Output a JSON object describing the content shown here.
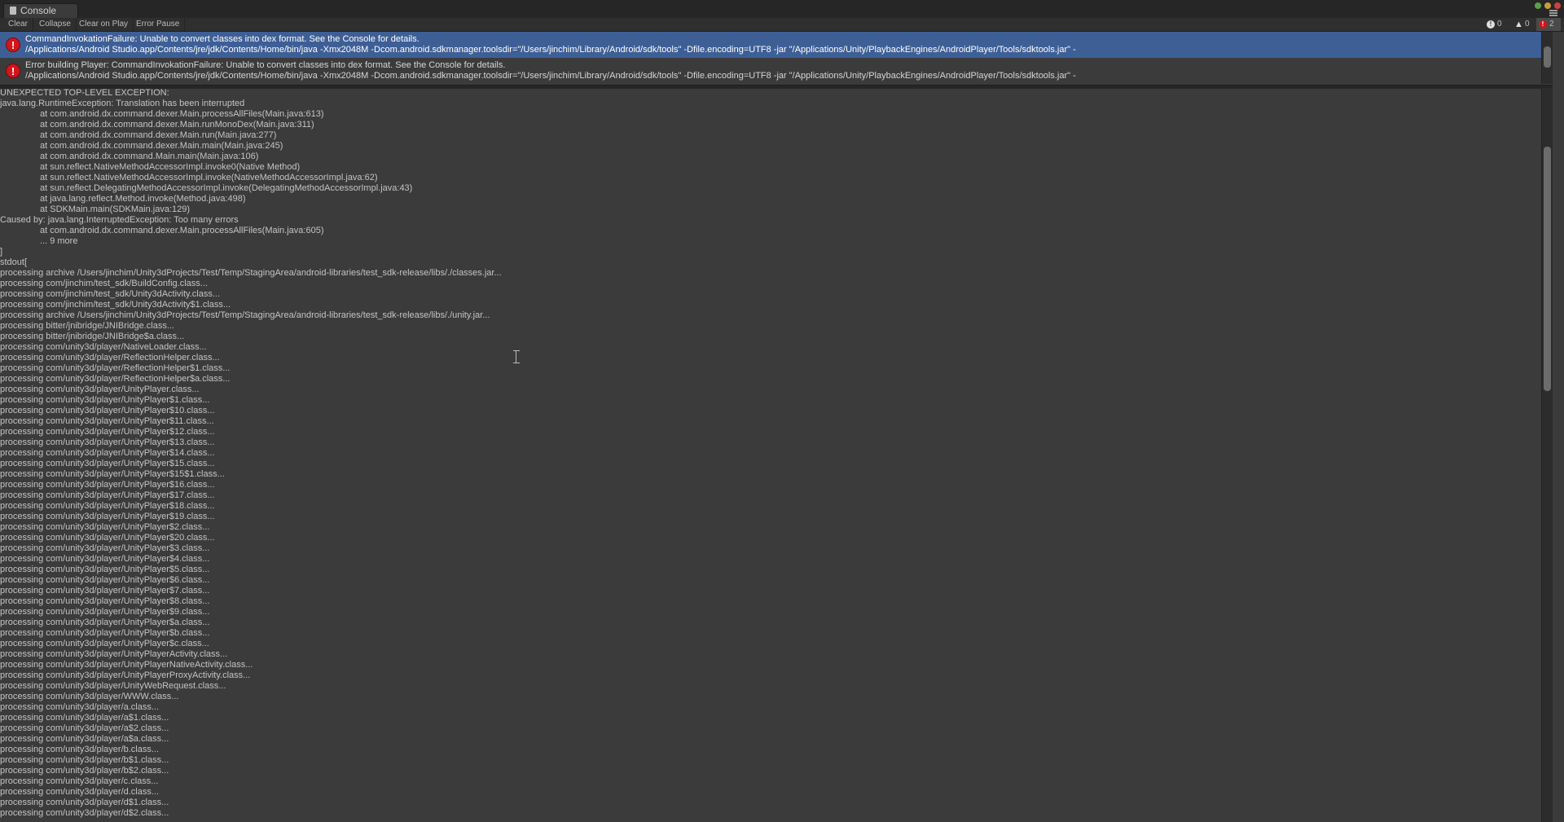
{
  "window": {
    "tab_title": "Console"
  },
  "toolbar": {
    "clear": "Clear",
    "collapse": "Collapse",
    "clear_on_play": "Clear on Play",
    "error_pause": "Error Pause",
    "info_count": "0",
    "warning_count": "0",
    "error_count": "2"
  },
  "entries": [
    {
      "line1": "CommandInvokationFailure: Unable to convert classes into dex format. See the Console for details.",
      "line2": "/Applications/Android Studio.app/Contents/jre/jdk/Contents/Home/bin/java -Xmx2048M -Dcom.android.sdkmanager.toolsdir=\"/Users/jinchim/Library/Android/sdk/tools\" -Dfile.encoding=UTF8 -jar \"/Applications/Unity/PlaybackEngines/AndroidPlayer/Tools/sdktools.jar\" -",
      "selected": true
    },
    {
      "line1": "Error building Player: CommandInvokationFailure: Unable to convert classes into dex format. See the Console for details.",
      "line2": "/Applications/Android Studio.app/Contents/jre/jdk/Contents/Home/bin/java -Xmx2048M -Dcom.android.sdkmanager.toolsdir=\"/Users/jinchim/Library/Android/sdk/tools\" -Dfile.encoding=UTF8 -jar \"/Applications/Unity/PlaybackEngines/AndroidPlayer/Tools/sdktools.jar\" -",
      "selected": false
    }
  ],
  "detail": {
    "lines": [
      "UNEXPECTED TOP-LEVEL EXCEPTION:",
      "java.lang.RuntimeException: Translation has been interrupted",
      "at com.android.dx.command.dexer.Main.processAllFiles(Main.java:613)",
      "at com.android.dx.command.dexer.Main.runMonoDex(Main.java:311)",
      "at com.android.dx.command.dexer.Main.run(Main.java:277)",
      "at com.android.dx.command.dexer.Main.main(Main.java:245)",
      "at com.android.dx.command.Main.main(Main.java:106)",
      "at sun.reflect.NativeMethodAccessorImpl.invoke0(Native Method)",
      "at sun.reflect.NativeMethodAccessorImpl.invoke(NativeMethodAccessorImpl.java:62)",
      "at sun.reflect.DelegatingMethodAccessorImpl.invoke(DelegatingMethodAccessorImpl.java:43)",
      "at java.lang.reflect.Method.invoke(Method.java:498)",
      "at SDKMain.main(SDKMain.java:129)",
      "Caused by: java.lang.InterruptedException: Too many errors",
      "at com.android.dx.command.dexer.Main.processAllFiles(Main.java:605)",
      "... 9 more",
      "]",
      "stdout[",
      "processing archive /Users/jinchim/Unity3dProjects/Test/Temp/StagingArea/android-libraries/test_sdk-release/libs/./classes.jar...",
      "processing com/jinchim/test_sdk/BuildConfig.class...",
      "processing com/jinchim/test_sdk/Unity3dActivity.class...",
      "processing com/jinchim/test_sdk/Unity3dActivity$1.class...",
      "processing archive /Users/jinchim/Unity3dProjects/Test/Temp/StagingArea/android-libraries/test_sdk-release/libs/./unity.jar...",
      "processing bitter/jnibridge/JNIBridge.class...",
      "processing bitter/jnibridge/JNIBridge$a.class...",
      "processing com/unity3d/player/NativeLoader.class...",
      "processing com/unity3d/player/ReflectionHelper.class...",
      "processing com/unity3d/player/ReflectionHelper$1.class...",
      "processing com/unity3d/player/ReflectionHelper$a.class...",
      "processing com/unity3d/player/UnityPlayer.class...",
      "processing com/unity3d/player/UnityPlayer$1.class...",
      "processing com/unity3d/player/UnityPlayer$10.class...",
      "processing com/unity3d/player/UnityPlayer$11.class...",
      "processing com/unity3d/player/UnityPlayer$12.class...",
      "processing com/unity3d/player/UnityPlayer$13.class...",
      "processing com/unity3d/player/UnityPlayer$14.class...",
      "processing com/unity3d/player/UnityPlayer$15.class...",
      "processing com/unity3d/player/UnityPlayer$15$1.class...",
      "processing com/unity3d/player/UnityPlayer$16.class...",
      "processing com/unity3d/player/UnityPlayer$17.class...",
      "processing com/unity3d/player/UnityPlayer$18.class...",
      "processing com/unity3d/player/UnityPlayer$19.class...",
      "processing com/unity3d/player/UnityPlayer$2.class...",
      "processing com/unity3d/player/UnityPlayer$20.class...",
      "processing com/unity3d/player/UnityPlayer$3.class...",
      "processing com/unity3d/player/UnityPlayer$4.class...",
      "processing com/unity3d/player/UnityPlayer$5.class...",
      "processing com/unity3d/player/UnityPlayer$6.class...",
      "processing com/unity3d/player/UnityPlayer$7.class...",
      "processing com/unity3d/player/UnityPlayer$8.class...",
      "processing com/unity3d/player/UnityPlayer$9.class...",
      "processing com/unity3d/player/UnityPlayer$a.class...",
      "processing com/unity3d/player/UnityPlayer$b.class...",
      "processing com/unity3d/player/UnityPlayer$c.class...",
      "processing com/unity3d/player/UnityPlayerActivity.class...",
      "processing com/unity3d/player/UnityPlayerNativeActivity.class...",
      "processing com/unity3d/player/UnityPlayerProxyActivity.class...",
      "processing com/unity3d/player/UnityWebRequest.class...",
      "processing com/unity3d/player/WWW.class...",
      "processing com/unity3d/player/a.class...",
      "processing com/unity3d/player/a$1.class...",
      "processing com/unity3d/player/a$2.class...",
      "processing com/unity3d/player/a$a.class...",
      "processing com/unity3d/player/b.class...",
      "processing com/unity3d/player/b$1.class...",
      "processing com/unity3d/player/b$2.class...",
      "processing com/unity3d/player/c.class...",
      "processing com/unity3d/player/d.class...",
      "processing com/unity3d/player/d$1.class...",
      "processing com/unity3d/player/d$2.class..."
    ],
    "indented": [
      2,
      3,
      4,
      5,
      6,
      7,
      8,
      9,
      10,
      11,
      13,
      14
    ]
  },
  "colors": {
    "selected_row": "#3e5f96",
    "error_red": "#d1151b",
    "background": "#3b3b3b"
  }
}
